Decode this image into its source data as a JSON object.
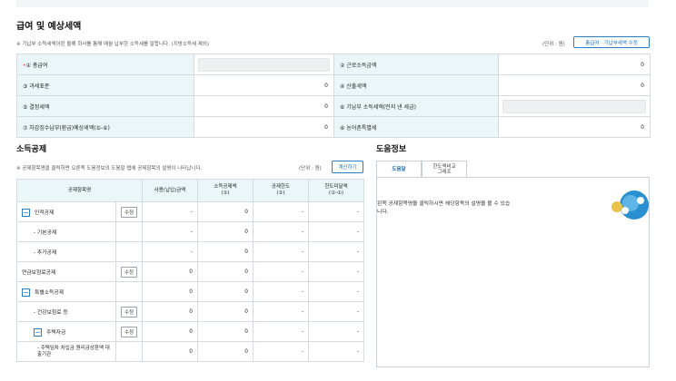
{
  "salary": {
    "title": "급여 및 예상세액",
    "note": "※ 기납부 소득세액이란 올해 회사를 통해 매월 납부한 소득세를 말합니다. (지방소득세 제외)",
    "unit": "(단위 : 원)",
    "edit_button": "총급여 · 기납부세액 수정",
    "rows": [
      {
        "l1": "① 총급여",
        "l1_required": "•",
        "v1": "",
        "l2": "② 근로소득금액",
        "v2": "0"
      },
      {
        "l1": "③ 과세표준",
        "v1": "0",
        "l2": "④ 산출세액",
        "v2": "0"
      },
      {
        "l1": "⑤ 결정세액",
        "v1": "0",
        "l2": "⑥ 기납부 소득세액(먼저 낸 세금)",
        "v2": ""
      },
      {
        "l1": "⑦ 차감징수납부(환급)예상세액(⑤-⑥)",
        "v1": "0",
        "l2": "⑧ 농어촌특별세",
        "v2": "0"
      }
    ]
  },
  "deduction": {
    "title": "소득공제",
    "note": "※ 공제항목명을 클릭하면 오른쪽 도움정보의 도움말 탭에 공제항목의 설명이 나타납니다.",
    "unit": "(단위 : 원)",
    "calc_button": "계산하기",
    "headers": [
      "공제항목명",
      "사용(납입)금액",
      "소득공제액\n(①)",
      "공제한도\n(②)",
      "한도미달액\n(②-①)"
    ],
    "rows": [
      {
        "name": "인적공제",
        "toggle": "−",
        "edit": "수정",
        "used": "-",
        "ded": "0",
        "limit": "-",
        "short": "-"
      },
      {
        "name": "- 기본공제",
        "used": "-",
        "ded": "0",
        "limit": "-",
        "short": "-"
      },
      {
        "name": "- 추가공제",
        "used": "-",
        "ded": "0",
        "limit": "-",
        "short": "-"
      },
      {
        "name": "연금보험료공제",
        "edit": "수정",
        "used": "0",
        "ded": "0",
        "limit": "-",
        "short": "-"
      },
      {
        "name": "특별소득공제",
        "toggle": "−",
        "used": "0",
        "ded": "0",
        "limit": "-",
        "short": "-"
      },
      {
        "name": "- 건강보험료 등",
        "edit": "수정",
        "used": "0",
        "ded": "0",
        "limit": "-",
        "short": "-"
      },
      {
        "name": "주택자금",
        "toggle": "−",
        "edit": "수정",
        "used": "0",
        "ded": "0",
        "limit": "-",
        "short": "-"
      },
      {
        "name": "- 주택임차 차입금 원리금상환액 대출기관",
        "used": "0",
        "ded": "0",
        "limit": "-",
        "short": "-"
      }
    ]
  },
  "help": {
    "title": "도움정보",
    "tabs": [
      "도움말",
      "한도액비교\n그래프"
    ],
    "text": "왼쪽 공제항목명을 클릭하시면 해당항목의 설명을 볼 수 있습니다."
  }
}
